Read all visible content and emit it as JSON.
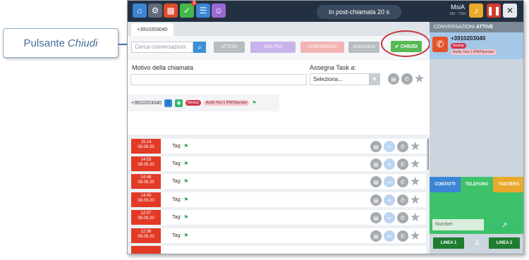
{
  "callout": {
    "prefix": "Pulsante",
    "emphasis": "Chiudi"
  },
  "topbar": {
    "icons": [
      "home-icon",
      "gear-icon",
      "calendar-icon",
      "check-icon",
      "list-icon",
      "contacts-icon"
    ],
    "check_badge": "3",
    "status": "In post-chiamata 20 s",
    "user_name": "MsiA",
    "user_sub": "183 · 7221"
  },
  "conversation_tab": "+3910203040",
  "search": {
    "placeholder": "Cerca conversazioni"
  },
  "toolbar_buttons": [
    {
      "label": "ATTESA",
      "color": "#b7bcc1"
    },
    {
      "label": "INOLTRA",
      "color": "#c7b3ea"
    },
    {
      "label": "CONFERENZA",
      "color": "#f2b3b3"
    },
    {
      "label": "AGGANCIA",
      "color": "#b7bcc1"
    }
  ],
  "chiudi_label": "CHIUDI",
  "motivo_label": "Motivo della chiamata",
  "assegna": {
    "label": "Assegna Task a:",
    "selected": "Seleziona..."
  },
  "contact": {
    "number": "+3910203040",
    "tag_nextup": "Nextup",
    "tag_operator": "Audio Test 1 IFM/Operator"
  },
  "history": [
    {
      "time": "15:14",
      "date": "08.09.20"
    },
    {
      "time": "14:53",
      "date": "08.09.20"
    },
    {
      "time": "14:46",
      "date": "08.09.20"
    },
    {
      "time": "14:45",
      "date": "08.09.20"
    },
    {
      "time": "12:57",
      "date": "08.09.20"
    },
    {
      "time": "12:36",
      "date": "08.09.20"
    }
  ],
  "tag_label": "Tag:",
  "right_panel": {
    "header_prefix": "CONVERSAZIONI",
    "header_strong": "ATTIVE",
    "active_number": "+3910203040",
    "active_tag": "Nextup",
    "active_operator": "Audio Test 1 IFM/Operator",
    "tabs": [
      "CONTATTI",
      "TELEFONO",
      "TASTIERA"
    ],
    "number_placeholder": "Number",
    "line1": "LINEA 1",
    "line2": "LINEA 2"
  },
  "colors": {
    "accent_green": "#57b955",
    "call_red": "#e23a26",
    "topbar": "#233041",
    "highlight": "#c2353a"
  }
}
